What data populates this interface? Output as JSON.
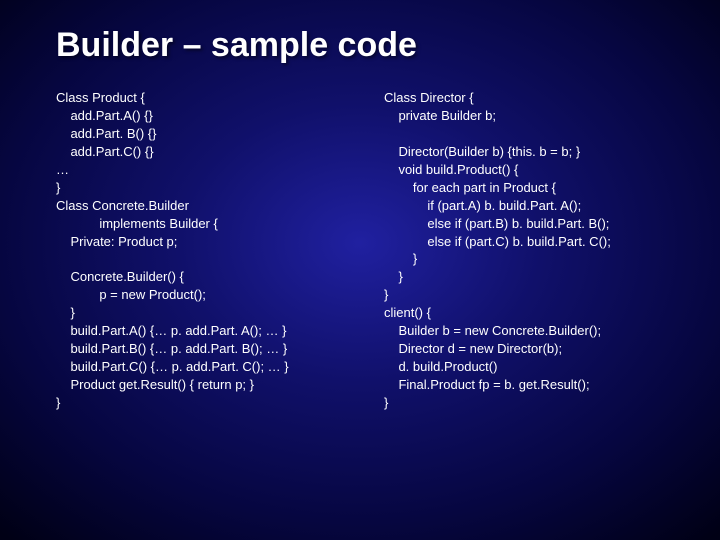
{
  "title": "Builder – sample code",
  "left": "Class Product {\n    add.Part.A() {}\n    add.Part. B() {}\n    add.Part.C() {}\n…\n}\nClass Concrete.Builder\n            implements Builder {\n    Private: Product p;\n\n    Concrete.Builder() {\n            p = new Product();\n    }\n    build.Part.A() {… p. add.Part. A(); … }\n    build.Part.B() {… p. add.Part. B(); … }\n    build.Part.C() {… p. add.Part. C(); … }\n    Product get.Result() { return p; }\n}",
  "right": "Class Director {\n    private Builder b;\n\n    Director(Builder b) {this. b = b; }\n    void build.Product() {\n        for each part in Product {\n            if (part.A) b. build.Part. A();\n            else if (part.B) b. build.Part. B();\n            else if (part.C) b. build.Part. C();\n        }\n    }\n}\nclient() {\n    Builder b = new Concrete.Builder();\n    Director d = new Director(b);\n    d. build.Product()\n    Final.Product fp = b. get.Result();\n}"
}
